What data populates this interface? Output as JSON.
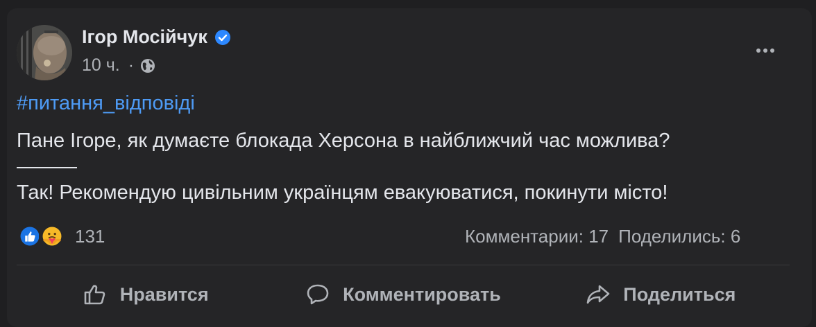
{
  "post": {
    "author_name": "Ігор Мосійчук",
    "verified_icon": "verified-badge-icon",
    "time": "10 ч.",
    "separator": "·",
    "privacy_icon": "globe-icon",
    "more_icon": "more-options-icon",
    "hashtag": "#питання_відповіді",
    "question": "Пане Ігоре, як думаєте блокада Херсона в найближчий час можлива?",
    "answer": "Так! Рекомендую цивільним українцям евакуюватися, покинути місто!"
  },
  "reactions": {
    "icons": [
      "like-reaction-icon",
      "care-reaction-icon"
    ],
    "count": "131"
  },
  "stats": {
    "comments": "Комментарии: 17",
    "shares": "Поделились: 6"
  },
  "actions": {
    "like": "Нравится",
    "comment": "Комментировать",
    "share": "Поделиться"
  },
  "colors": {
    "background": "#1f1f21",
    "card": "#252527",
    "text": "#e4e6eb",
    "secondary_text": "#b0b3b8",
    "link": "#4e9bf5",
    "verified": "#2d88ff"
  }
}
